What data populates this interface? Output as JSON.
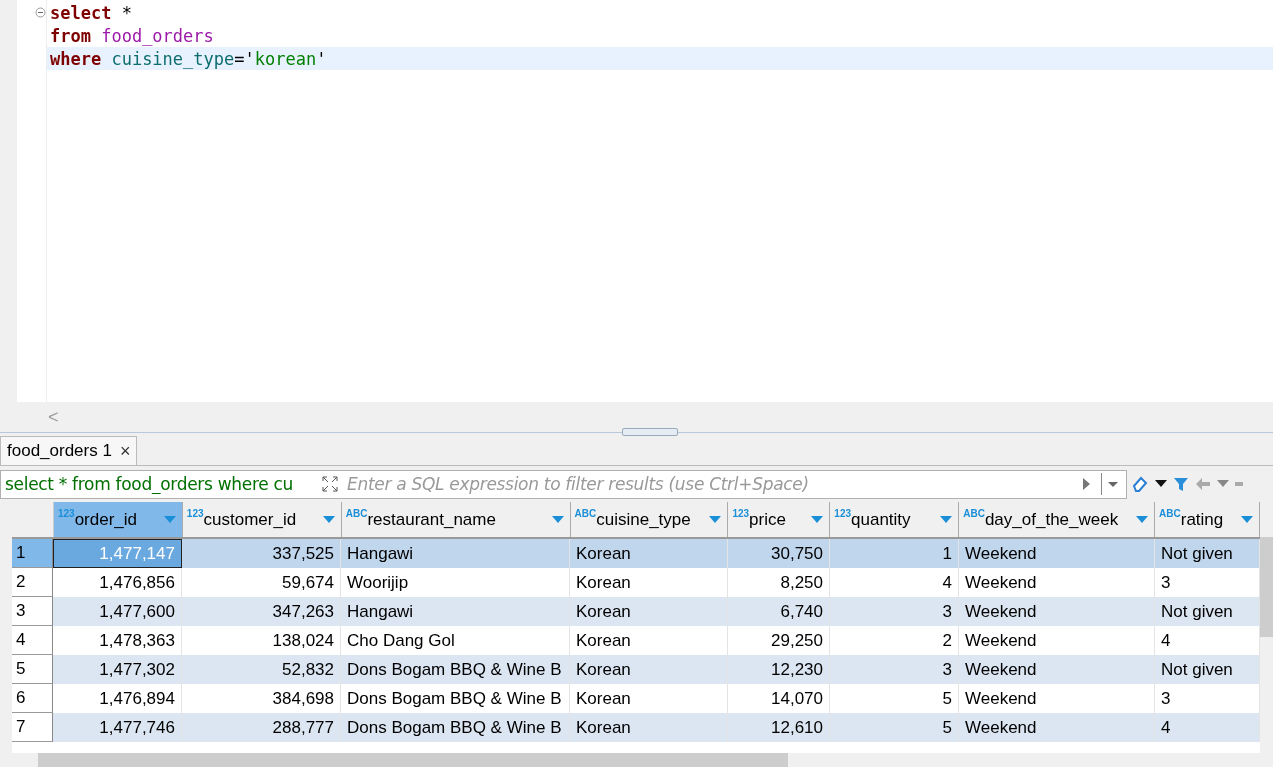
{
  "editor": {
    "lines": [
      {
        "tokens": [
          {
            "kind": "keyword",
            "text": "select"
          },
          {
            "kind": "plain",
            "text": " *"
          }
        ],
        "current": false,
        "foldable": true
      },
      {
        "tokens": [
          {
            "kind": "keyword",
            "text": "from "
          },
          {
            "kind": "table",
            "text": "food_orders"
          }
        ],
        "current": false,
        "foldable": false
      },
      {
        "tokens": [
          {
            "kind": "keyword",
            "text": "where "
          },
          {
            "kind": "column",
            "text": "cuisine_type"
          },
          {
            "kind": "plain",
            "text": "='"
          },
          {
            "kind": "string",
            "text": "korean"
          },
          {
            "kind": "plain",
            "text": "'"
          }
        ],
        "current": true,
        "foldable": false
      }
    ],
    "scroll_left": "<"
  },
  "results_tab": {
    "label": "food_orders 1",
    "close": "×",
    "selected": true
  },
  "filter": {
    "query": "select * from food_orders where cu",
    "placeholder": "Enter a SQL expression to filter results (use Ctrl+Space)"
  },
  "table": {
    "columns": [
      {
        "type": "123",
        "kind": "number",
        "name": "order_id",
        "selected": true
      },
      {
        "type": "123",
        "kind": "number",
        "name": "customer_id",
        "selected": false
      },
      {
        "type": "ABC",
        "kind": "text",
        "name": "restaurant_name",
        "selected": false
      },
      {
        "type": "ABC",
        "kind": "text",
        "name": "cuisine_type",
        "selected": false
      },
      {
        "type": "123",
        "kind": "number",
        "name": "price",
        "selected": false
      },
      {
        "type": "123",
        "kind": "number",
        "name": "quantity",
        "selected": false
      },
      {
        "type": "ABC",
        "kind": "text",
        "name": "day_of_the_week",
        "selected": false
      },
      {
        "type": "ABC",
        "kind": "text",
        "name": "rating",
        "selected": false
      }
    ],
    "rows": [
      {
        "number": "1",
        "selected": true,
        "cells": [
          "1,477,147",
          "337,525",
          "Hangawi",
          "Korean",
          "30,750",
          "1",
          "Weekend",
          "Not given"
        ]
      },
      {
        "number": "2",
        "selected": false,
        "cells": [
          "1,476,856",
          "59,674",
          "Woorijip",
          "Korean",
          "8,250",
          "4",
          "Weekend",
          "3"
        ]
      },
      {
        "number": "3",
        "selected": false,
        "cells": [
          "1,477,600",
          "347,263",
          "Hangawi",
          "Korean",
          "6,740",
          "3",
          "Weekend",
          "Not given"
        ]
      },
      {
        "number": "4",
        "selected": false,
        "cells": [
          "1,478,363",
          "138,024",
          "Cho Dang Gol",
          "Korean",
          "29,250",
          "2",
          "Weekend",
          "4"
        ]
      },
      {
        "number": "5",
        "selected": false,
        "cells": [
          "1,477,302",
          "52,832",
          "Dons Bogam BBQ & Wine B",
          "Korean",
          "12,230",
          "3",
          "Weekend",
          "Not given"
        ]
      },
      {
        "number": "6",
        "selected": false,
        "cells": [
          "1,476,894",
          "384,698",
          "Dons Bogam BBQ & Wine B",
          "Korean",
          "14,070",
          "5",
          "Weekend",
          "3"
        ]
      },
      {
        "number": "7",
        "selected": false,
        "cells": [
          "1,477,746",
          "288,777",
          "Dons Bogam BBQ & Wine B",
          "Korean",
          "12,610",
          "5",
          "Weekend",
          "4"
        ]
      }
    ]
  }
}
